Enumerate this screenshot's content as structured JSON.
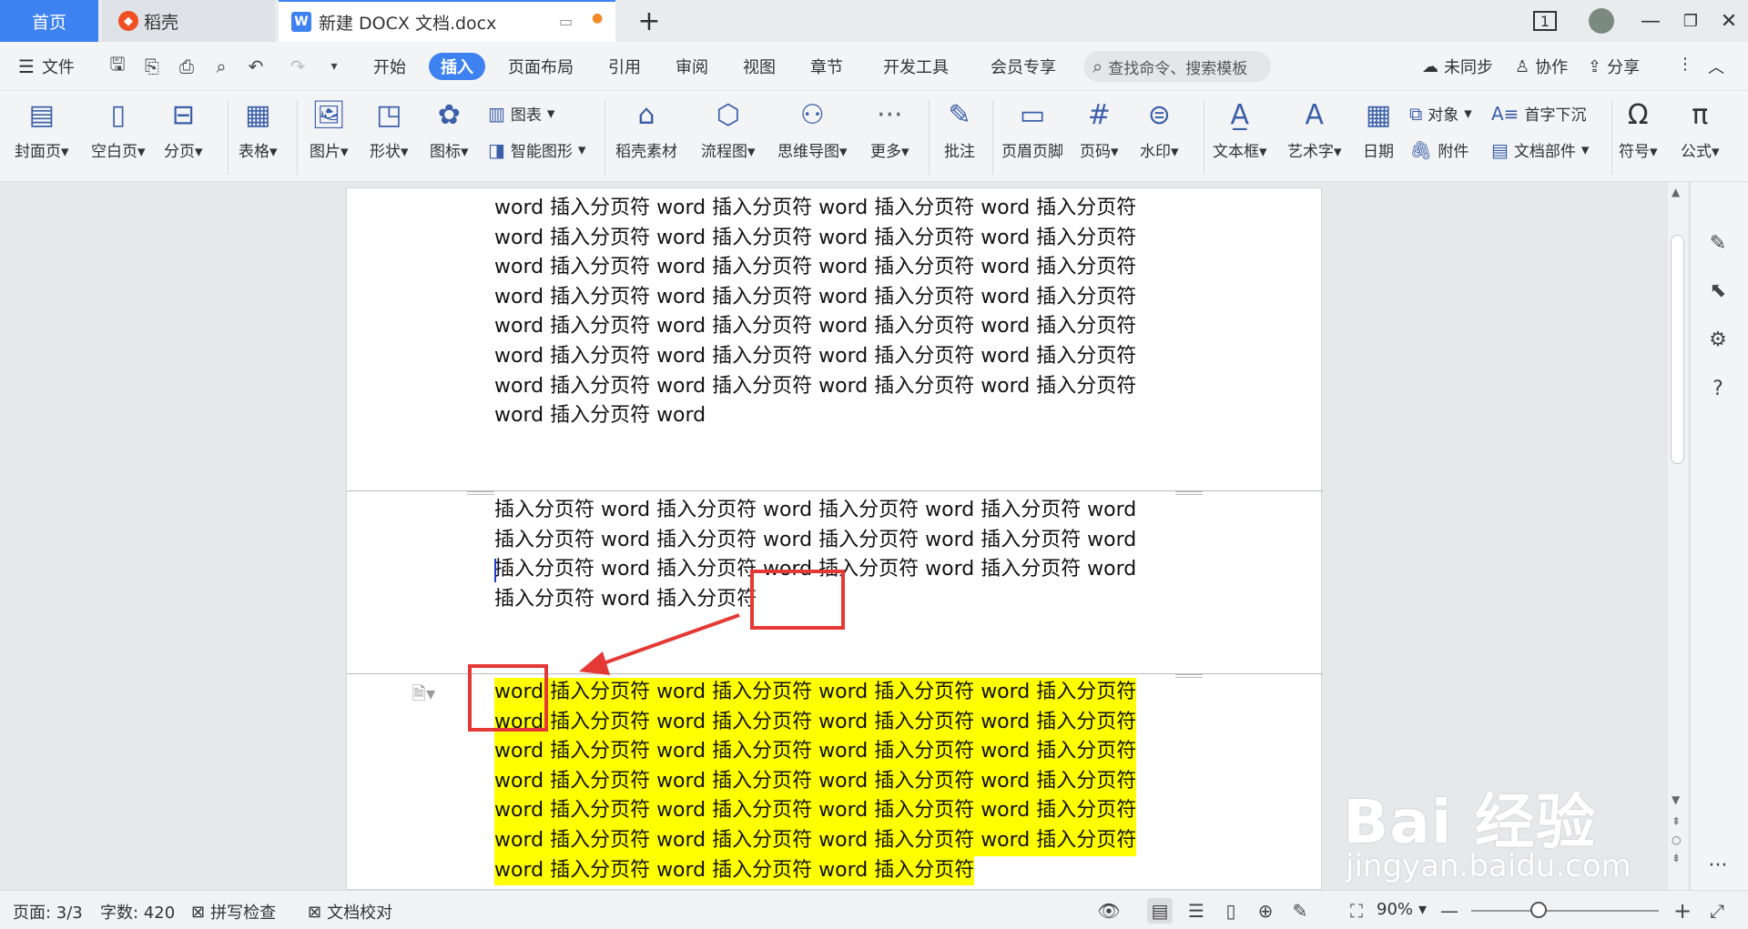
{
  "tabs": {
    "home": "首页",
    "daoke": "稻壳",
    "doc": "新建 DOCX 文档.docx"
  },
  "menu": {
    "file": "文件",
    "items": [
      "开始",
      "插入",
      "页面布局",
      "引用",
      "审阅",
      "视图",
      "章节",
      "开发工具",
      "会员专享"
    ],
    "active": "插入",
    "search_placeholder": "查找命令、搜索模板",
    "sync": "未同步",
    "collab": "协作",
    "share": "分享"
  },
  "ribbon": {
    "cover": "封面页",
    "blank": "空白页",
    "pagebreak": "分页",
    "table": "表格",
    "picture": "图片",
    "shape": "形状",
    "icon": "图标",
    "chart": "图表",
    "smartart": "智能图形",
    "daoke_material": "稻壳素材",
    "flowchart": "流程图",
    "mindmap": "思维导图",
    "more": "更多",
    "comment": "批注",
    "header_footer": "页眉页脚",
    "page_number": "页码",
    "watermark": "水印",
    "textbox": "文本框",
    "wordart": "艺术字",
    "date": "日期",
    "object": "对象",
    "dropcap": "首字下沉",
    "attachment": "附件",
    "docpart": "文档部件",
    "symbol": "符号",
    "formula": "公式"
  },
  "document": {
    "block1": [
      "word 插入分页符 word 插入分页符 word 插入分页符 word 插入分页符",
      "word 插入分页符 word 插入分页符 word 插入分页符 word 插入分页符",
      "word 插入分页符 word 插入分页符 word 插入分页符 word 插入分页符",
      "word 插入分页符 word 插入分页符 word 插入分页符 word 插入分页符",
      "word 插入分页符 word 插入分页符 word 插入分页符 word 插入分页符",
      "word 插入分页符 word 插入分页符 word 插入分页符 word 插入分页符",
      "word 插入分页符 word 插入分页符 word 插入分页符 word 插入分页符",
      "word 插入分页符 word"
    ],
    "block2": [
      "插入分页符 word 插入分页符 word 插入分页符 word 插入分页符 word",
      "插入分页符 word 插入分页符 word 插入分页符 word 插入分页符 word",
      "插入分页符 word 插入分页符 word 插入分页符 word 插入分页符 word",
      "插入分页符 word 插入分页符"
    ],
    "block3": [
      "word 插入分页符 word 插入分页符 word 插入分页符 word 插入分页符",
      "word 插入分页符 word 插入分页符 word 插入分页符 word 插入分页符",
      "word 插入分页符 word 插入分页符 word 插入分页符 word 插入分页符",
      "word 插入分页符 word 插入分页符 word 插入分页符 word 插入分页符",
      "word 插入分页符 word 插入分页符 word 插入分页符 word 插入分页符",
      "word 插入分页符 word 插入分页符 word 插入分页符 word 插入分页符",
      "word 插入分页符 word 插入分页符 word 插入分页符"
    ]
  },
  "status": {
    "page": "页面: 3/3",
    "wordcount": "字数: 420",
    "spellcheck": "拼写检查",
    "proofread": "文档校对",
    "zoom": "90%",
    "zoom_fraction": 0.36
  },
  "watermark": {
    "brand": "Bai 经验",
    "url": "jingyan.baidu.com"
  },
  "colors": {
    "accent": "#3d82f0",
    "highlight": "#ffff00",
    "annotation": "#e53935"
  }
}
